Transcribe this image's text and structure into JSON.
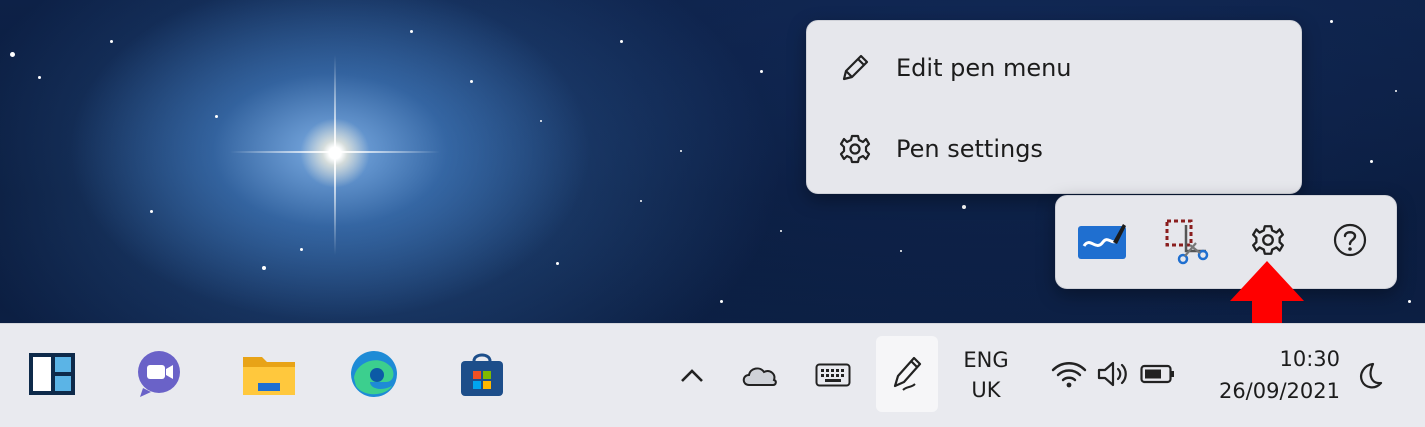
{
  "pen_menu": {
    "items": [
      {
        "label": "Edit pen menu",
        "icon": "pencil-icon"
      },
      {
        "label": "Pen settings",
        "icon": "gear-icon"
      }
    ]
  },
  "pen_flyout": {
    "buttons": [
      {
        "name": "whiteboard-icon"
      },
      {
        "name": "snipping-tool-icon"
      },
      {
        "name": "gear-icon"
      },
      {
        "name": "help-icon"
      }
    ]
  },
  "annotation": {
    "color": "#ff0000"
  },
  "taskbar": {
    "pinned": [
      "start-icon",
      "teams-icon",
      "file-explorer-icon",
      "edge-icon",
      "store-icon"
    ],
    "tray": {
      "language_line1": "ENG",
      "language_line2": "UK",
      "time": "10:30",
      "date": "26/09/2021"
    }
  }
}
